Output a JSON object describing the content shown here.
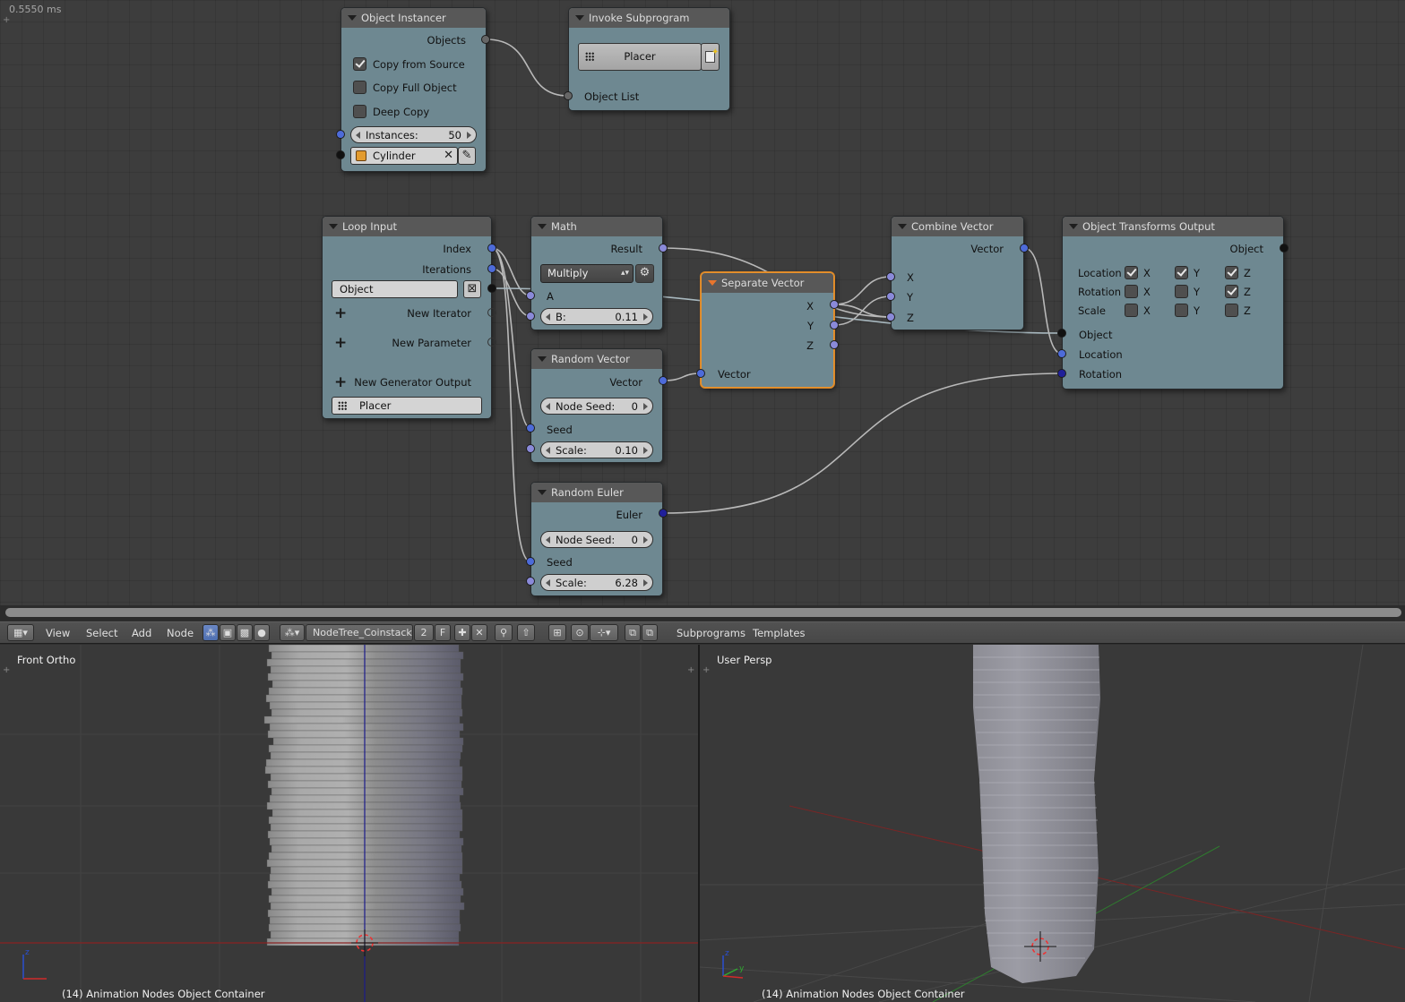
{
  "timing": "0.5550 ms",
  "nodes": {
    "object_instancer": {
      "title": "Object Instancer",
      "objects_label": "Objects",
      "copy_from_source": {
        "label": "Copy from Source",
        "checked": true
      },
      "copy_full_object": {
        "label": "Copy Full Object",
        "checked": false
      },
      "deep_copy": {
        "label": "Deep Copy",
        "checked": false
      },
      "instances_label": "Instances:",
      "instances_value": "50",
      "object_value": "Cylinder"
    },
    "invoke_subprogram": {
      "title": "Invoke Subprogram",
      "subprogram": "Placer",
      "object_list_label": "Object List"
    },
    "loop_input": {
      "title": "Loop Input",
      "index_label": "Index",
      "iterations_label": "Iterations",
      "object_field": "Object",
      "new_iterator": "New Iterator",
      "new_parameter": "New Parameter",
      "new_generator_output": "New Generator Output",
      "subprogram_name": "Placer"
    },
    "math": {
      "title": "Math",
      "result_label": "Result",
      "operation": "Multiply",
      "a_label": "A",
      "b_label": "B:",
      "b_value": "0.11"
    },
    "random_vector": {
      "title": "Random Vector",
      "vector_label": "Vector",
      "node_seed_label": "Node Seed:",
      "node_seed_value": "0",
      "seed_label": "Seed",
      "scale_label": "Scale:",
      "scale_value": "0.10"
    },
    "random_euler": {
      "title": "Random Euler",
      "euler_label": "Euler",
      "node_seed_label": "Node Seed:",
      "node_seed_value": "0",
      "seed_label": "Seed",
      "scale_label": "Scale:",
      "scale_value": "6.28"
    },
    "separate_vector": {
      "title": "Separate Vector",
      "x_label": "X",
      "y_label": "Y",
      "z_label": "Z",
      "vector_label": "Vector"
    },
    "combine_vector": {
      "title": "Combine Vector",
      "vector_label": "Vector",
      "x_label": "X",
      "y_label": "Y",
      "z_label": "Z"
    },
    "object_transforms_output": {
      "title": "Object Transforms Output",
      "object_out_label": "Object",
      "rows": [
        {
          "label": "Location",
          "x": true,
          "y": true,
          "z": true
        },
        {
          "label": "Rotation",
          "x": false,
          "y": false,
          "z": true
        },
        {
          "label": "Scale",
          "x": false,
          "y": false,
          "z": false
        }
      ],
      "axis_x": "X",
      "axis_y": "Y",
      "axis_z": "Z",
      "object_in_label": "Object",
      "location_in_label": "Location",
      "rotation_in_label": "Rotation"
    }
  },
  "header": {
    "menus": [
      "View",
      "Select",
      "Add",
      "Node"
    ],
    "node_tree": "NodeTree_Coinstack",
    "users": "2",
    "fake_user": "F",
    "subprograms": "Subprograms",
    "templates": "Templates"
  },
  "viewports": {
    "left": {
      "label": "Front Ortho",
      "footer": "(14) Animation Nodes Object Container"
    },
    "right": {
      "label": "User Persp",
      "footer": "(14) Animation Nodes Object Container"
    }
  },
  "colors": {
    "node_body": "#6e8891",
    "node_header": "#585858",
    "active_outline": "#e8922d",
    "editor_bg": "#3d3d3d",
    "viewport_bg": "#393939"
  }
}
